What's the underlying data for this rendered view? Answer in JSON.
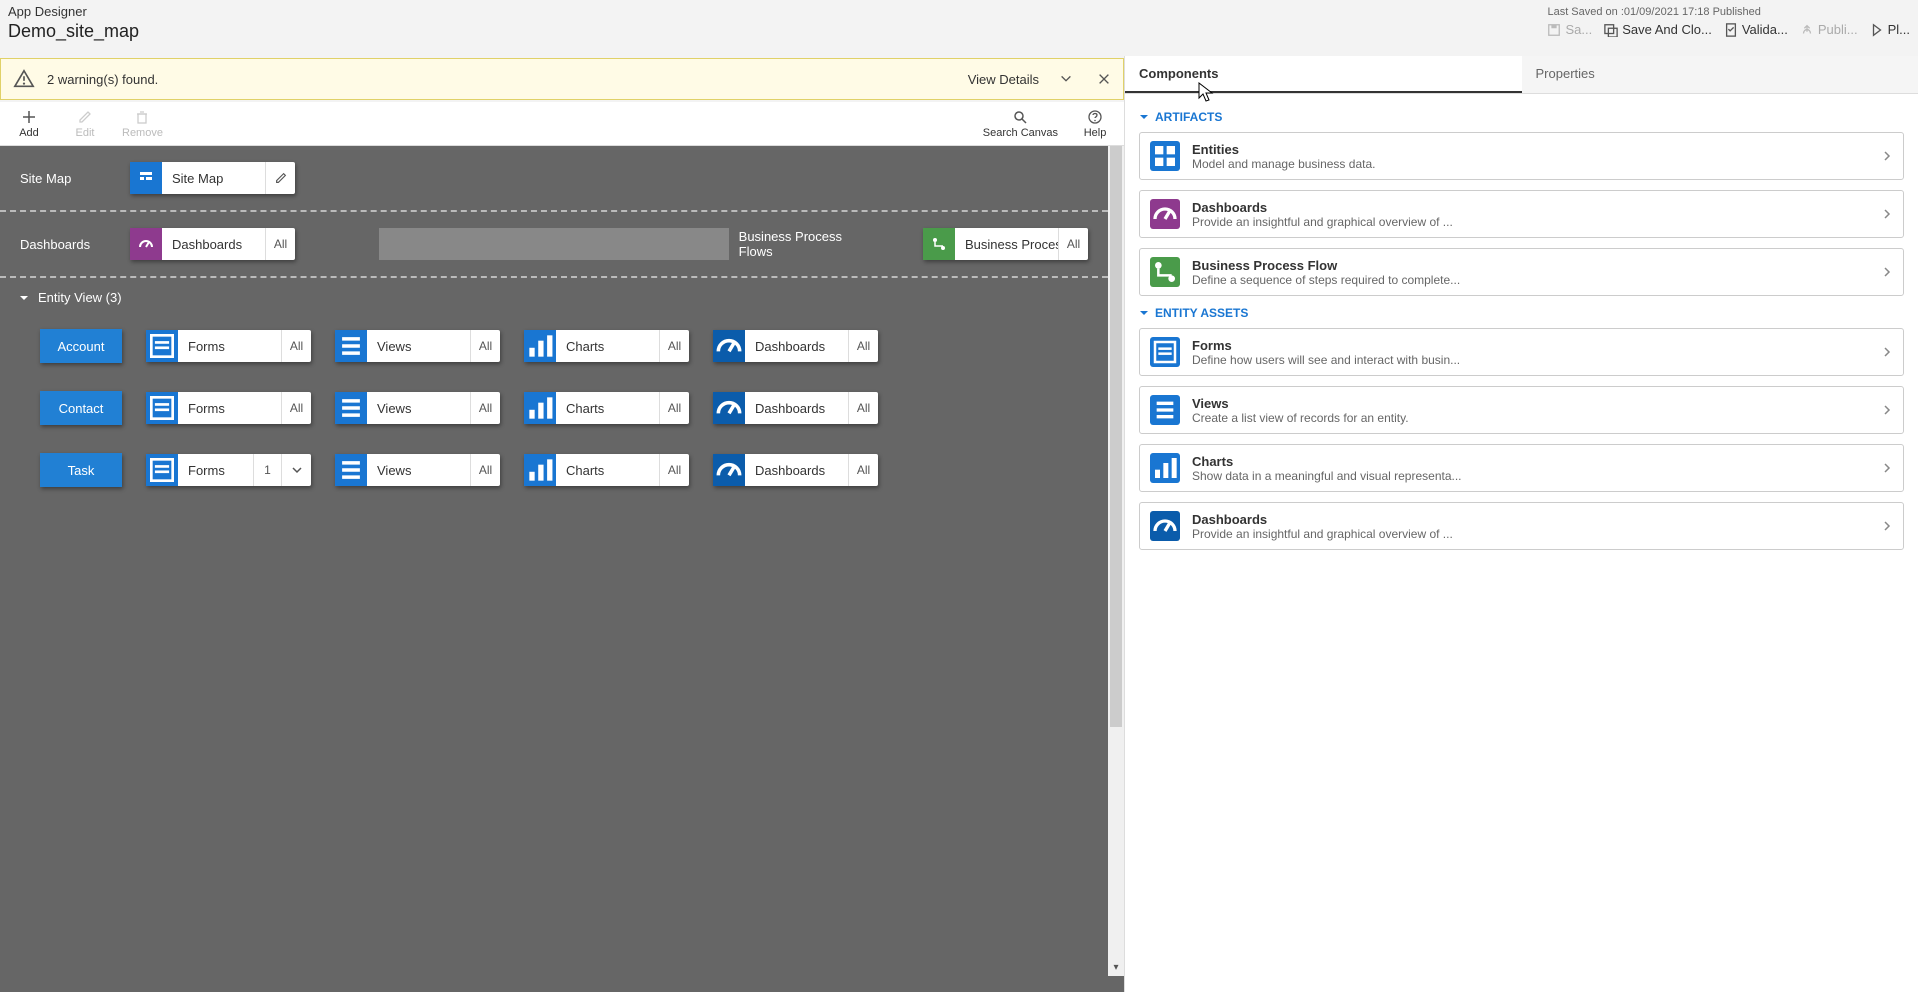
{
  "header": {
    "appTitle": "App Designer",
    "appName": "Demo_site_map",
    "savedText": "Last Saved on :01/09/2021 17:18 Published",
    "actions": {
      "save": "Sa...",
      "saveClose": "Save And Clo...",
      "validate": "Valida...",
      "publish": "Publi...",
      "play": "Pl..."
    }
  },
  "warning": {
    "text": "2 warning(s) found.",
    "viewDetails": "View Details"
  },
  "toolbar": {
    "add": "Add",
    "edit": "Edit",
    "remove": "Remove",
    "search": "Search Canvas",
    "help": "Help"
  },
  "canvas": {
    "sitemapLabel": "Site Map",
    "sitemapTile": "Site Map",
    "dashLabel": "Dashboards",
    "dashTile": "Dashboards",
    "dashAll": "All",
    "bpfLabel": "Business Process Flows",
    "bpfTile": "Business Proces...",
    "bpfAll": "All",
    "entityHeader": "Entity View (3)",
    "entities": [
      {
        "name": "Account",
        "forms": "Forms",
        "formsR": "All",
        "views": "Views",
        "viewsR": "All",
        "charts": "Charts",
        "chartsR": "All",
        "dash": "Dashboards",
        "dashR": "All"
      },
      {
        "name": "Contact",
        "forms": "Forms",
        "formsR": "All",
        "views": "Views",
        "viewsR": "All",
        "charts": "Charts",
        "chartsR": "All",
        "dash": "Dashboards",
        "dashR": "All"
      },
      {
        "name": "Task",
        "forms": "Forms",
        "formsR": "1",
        "formsHasChevron": true,
        "views": "Views",
        "viewsR": "All",
        "charts": "Charts",
        "chartsR": "All",
        "dash": "Dashboards",
        "dashR": "All"
      }
    ]
  },
  "panel": {
    "tabComponents": "Components",
    "tabProperties": "Properties",
    "groupArtifacts": "ARTIFACTS",
    "groupEntityAssets": "ENTITY ASSETS",
    "artifacts": [
      {
        "title": "Entities",
        "desc": "Model and manage business data.",
        "color": "#1976d2",
        "icon": "grid"
      },
      {
        "title": "Dashboards",
        "desc": "Provide an insightful and graphical overview of ...",
        "color": "#8e3a8e",
        "icon": "gauge"
      },
      {
        "title": "Business Process Flow",
        "desc": "Define a sequence of steps required to complete...",
        "color": "#4a9b4a",
        "icon": "flow"
      }
    ],
    "assets": [
      {
        "title": "Forms",
        "desc": "Define how users will see and interact with busin...",
        "color": "#1976d2",
        "icon": "form"
      },
      {
        "title": "Views",
        "desc": "Create a list view of records for an entity.",
        "color": "#1976d2",
        "icon": "list"
      },
      {
        "title": "Charts",
        "desc": "Show data in a meaningful and visual representa...",
        "color": "#1976d2",
        "icon": "chart"
      },
      {
        "title": "Dashboards",
        "desc": "Provide an insightful and graphical overview of ...",
        "color": "#0b5cab",
        "icon": "gauge"
      }
    ]
  }
}
